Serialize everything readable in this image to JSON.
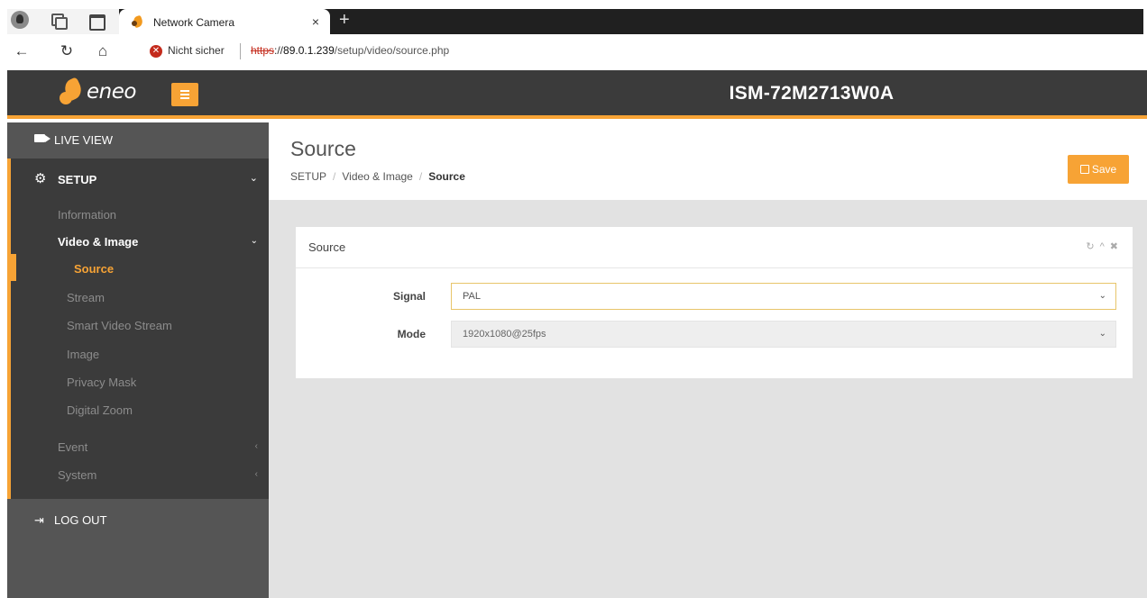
{
  "browser": {
    "tab_title": "Network Camera",
    "tab_close": "×",
    "new_tab": "+",
    "security_label": "Nicht sicher",
    "url_protocol": "https",
    "url_separator": "://",
    "url_host": "89.0.1.239",
    "url_path": "/setup/video/source.php"
  },
  "header": {
    "logo_text": "eneo",
    "device_name": "ISM-72M2713W0A"
  },
  "sidebar": {
    "live_view": "LIVE VIEW",
    "setup": "SETUP",
    "items": [
      {
        "label": "Information"
      },
      {
        "label": "Video & Image"
      },
      {
        "label": "Source"
      },
      {
        "label": "Stream"
      },
      {
        "label": "Smart Video Stream"
      },
      {
        "label": "Image"
      },
      {
        "label": "Privacy Mask"
      },
      {
        "label": "Digital Zoom"
      },
      {
        "label": "Event"
      },
      {
        "label": "System"
      }
    ],
    "logout": "LOG OUT"
  },
  "page": {
    "title": "Source",
    "breadcrumb": [
      "SETUP",
      "Video & Image",
      "Source"
    ],
    "save_label": "Save"
  },
  "panel": {
    "title": "Source",
    "fields": [
      {
        "label": "Signal",
        "value": "PAL"
      },
      {
        "label": "Mode",
        "value": "1920x1080@25fps"
      }
    ]
  },
  "colors": {
    "accent": "#f7a335",
    "header_bg": "#3b3b3b",
    "content_bg": "#e2e2e2"
  }
}
